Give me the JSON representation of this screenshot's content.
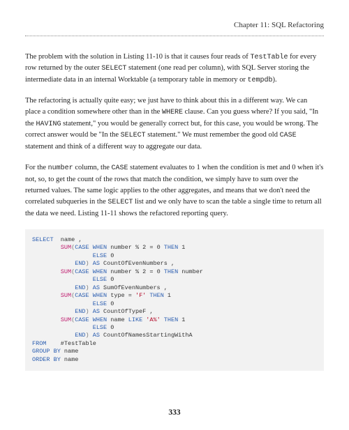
{
  "header": {
    "title": "Chapter 11: SQL Refactoring"
  },
  "para1": {
    "t1": "The problem with the solution in Listing 11-10 is that it causes four reads of ",
    "code1": "TestTable",
    "t2": " for every row returned by the outer ",
    "code2": "SELECT",
    "t3": " statement (one read per column), with SQL Server storing the intermediate data in an internal Worktable (a temporary table in memory or ",
    "code3": "tempdb",
    "t4": ")."
  },
  "para2": {
    "t1": "The refactoring is actually quite easy; we just have to think about this in a different way. We can place a condition somewhere other than in the ",
    "code1": "WHERE",
    "t2": " clause. Can you guess where? If you said, \"In the ",
    "code2": "HAVING",
    "t3": " statement,\" you would be generally correct but, for this case, you would be wrong. The correct answer would be \"In the ",
    "code3": "SELECT",
    "t4": " statement.\" We must remember the good old ",
    "code4": "CASE",
    "t5": " statement and think of a different way to aggregate our data."
  },
  "para3": {
    "t1": "For the ",
    "code1": "number",
    "t2": " column, the ",
    "code2": "CASE",
    "t3": " statement evaluates to 1 when the condition is met and 0 when it's not, so, to get the count of the rows that match the condition, we simply have to sum over the returned values. The same logic applies to the other aggregates, and means that we don't need the correlated subqueries in the ",
    "code3": "SELECT",
    "t4": " list and we only have to scan the table a single time to return all the data we need. Listing 11-11 shows the refactored reporting query."
  },
  "code": {
    "l1a": "SELECT",
    "l1b": "  name ,",
    "l2a": "        ",
    "l2b": "SUM",
    "l2c": "(",
    "l2d": "CASE WHEN",
    "l2e": " number % 2 = 0 ",
    "l2f": "THEN",
    "l2g": " 1",
    "l3a": "                 ",
    "l3b": "ELSE",
    "l3c": " 0",
    "l4a": "            ",
    "l4b": "END",
    "l4c": ") ",
    "l4d": "AS",
    "l4e": " CountOfEvenNumbers ,",
    "l5a": "        ",
    "l5b": "SUM",
    "l5c": "(",
    "l5d": "CASE WHEN",
    "l5e": " number % 2 = 0 ",
    "l5f": "THEN",
    "l5g": " number",
    "l6a": "                 ",
    "l6b": "ELSE",
    "l6c": " 0",
    "l7a": "            ",
    "l7b": "END",
    "l7c": ") ",
    "l7d": "AS",
    "l7e": " SumOfEvenNumbers ,",
    "l8a": "        ",
    "l8b": "SUM",
    "l8c": "(",
    "l8d": "CASE WHEN",
    "l8e": " type = ",
    "l8f": "'F'",
    "l8g": " ",
    "l8h": "THEN",
    "l8i": " 1",
    "l9a": "                 ",
    "l9b": "ELSE",
    "l9c": " 0",
    "l10a": "            ",
    "l10b": "END",
    "l10c": ") ",
    "l10d": "AS",
    "l10e": " CountOfTypeF ,",
    "l11a": "        ",
    "l11b": "SUM",
    "l11c": "(",
    "l11d": "CASE WHEN",
    "l11e": " name ",
    "l11f": "LIKE",
    "l11g": " ",
    "l11h": "'A%'",
    "l11i": " ",
    "l11j": "THEN",
    "l11k": " 1",
    "l12a": "                 ",
    "l12b": "ELSE",
    "l12c": " 0",
    "l13a": "            ",
    "l13b": "END",
    "l13c": ") ",
    "l13d": "AS",
    "l13e": " CountOfNamesStartingWithA",
    "l14a": "FROM",
    "l14b": "    #TestTable",
    "l15a": "GROUP BY",
    "l15b": " name",
    "l16a": "ORDER BY",
    "l16b": " name"
  },
  "pagenum": "333"
}
